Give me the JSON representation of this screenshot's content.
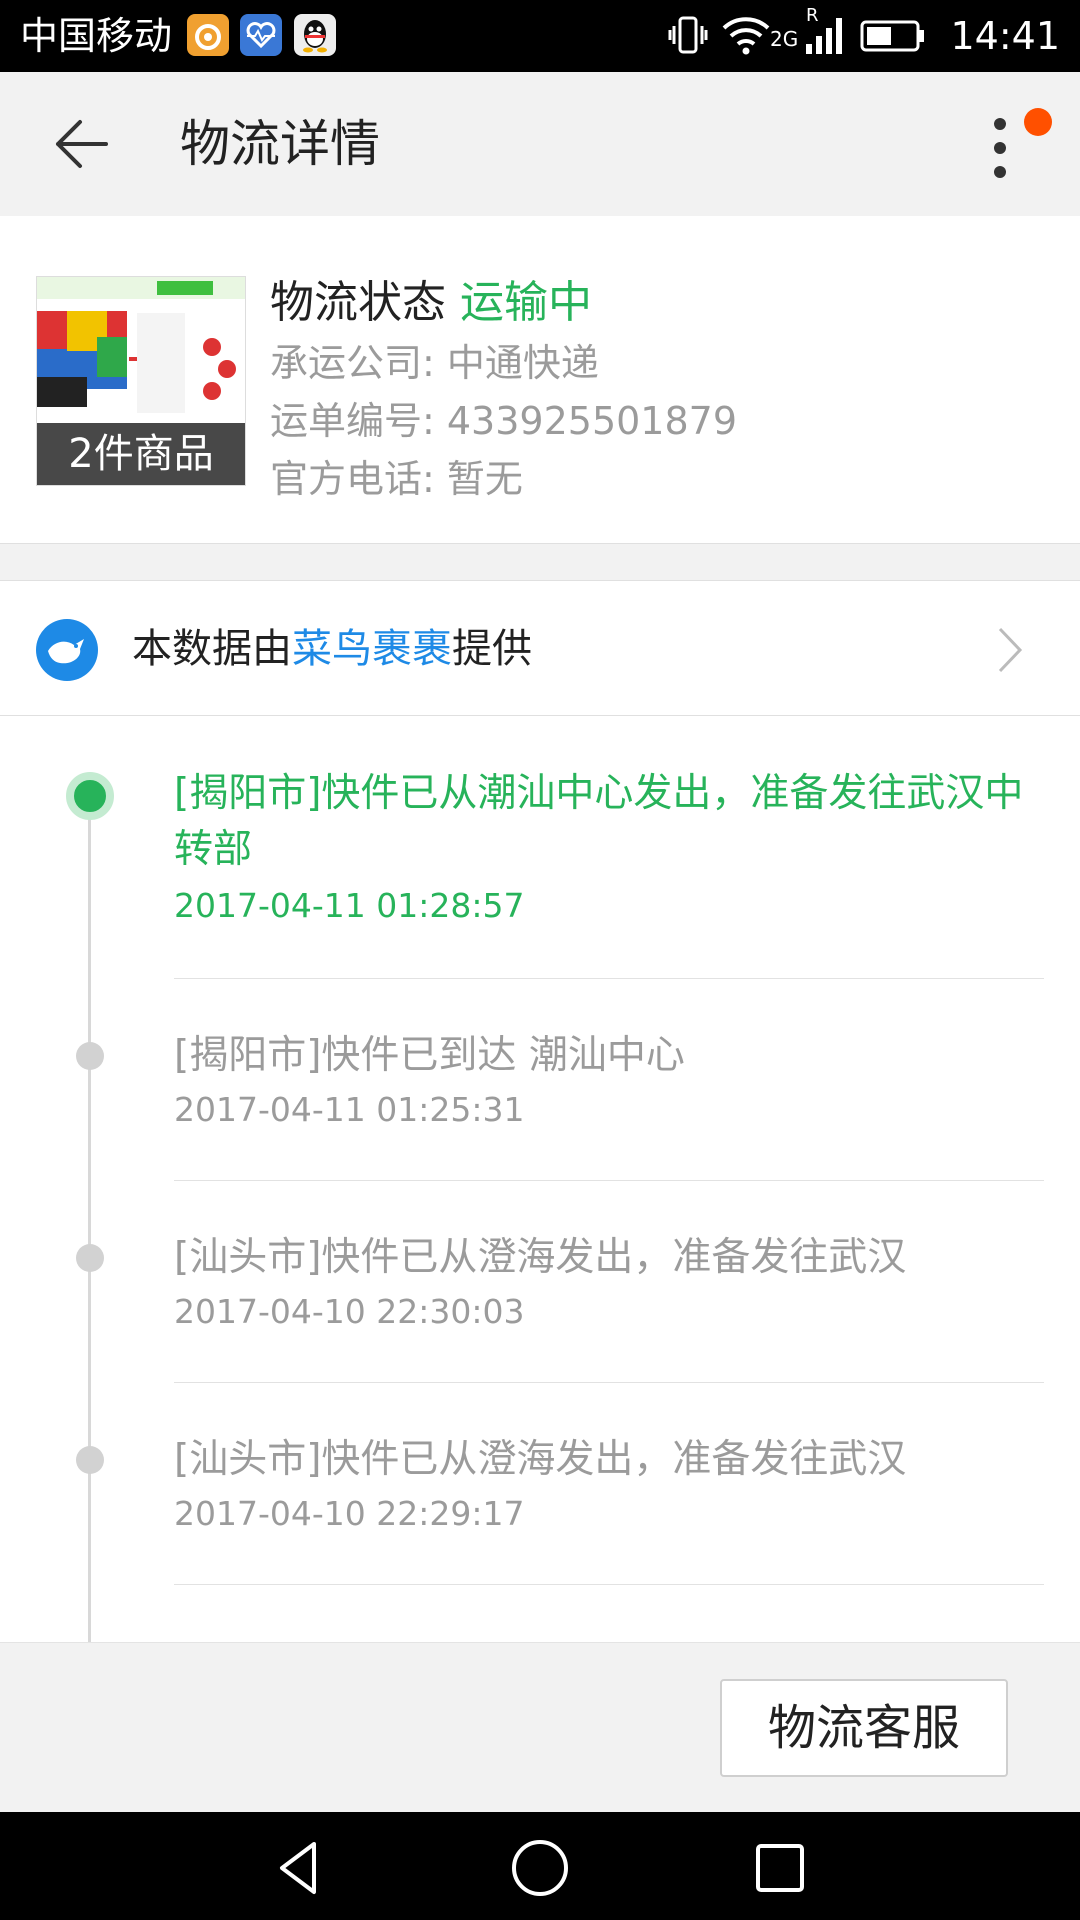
{
  "status_bar": {
    "carrier": "中国移动",
    "network": "2G",
    "roaming": "R",
    "time": "14:41",
    "app_icons": [
      "uc-browser-icon",
      "health-icon",
      "qq-icon"
    ]
  },
  "app_bar": {
    "title": "物流详情",
    "has_notification": true
  },
  "shipment": {
    "item_count_label": "2件商品",
    "status_label": "物流状态",
    "status_value": "运输中",
    "carrier_line": "承运公司: 中通快递",
    "tracking_line": "运单编号: 433925501879",
    "phone_line": "官方电话: 暂无"
  },
  "provider": {
    "prefix": "本数据由",
    "name": "菜鸟裹裹",
    "suffix": "提供"
  },
  "timeline": [
    {
      "description": "[揭阳市]快件已从潮汕中心发出，准备发往武汉中转部",
      "time": "2017-04-11 01:28:57",
      "current": true
    },
    {
      "description": "[揭阳市]快件已到达 潮汕中心",
      "time": "2017-04-11 01:25:31",
      "current": false
    },
    {
      "description": "[汕头市]快件已从澄海发出，准备发往武汉",
      "time": "2017-04-10 22:30:03",
      "current": false
    },
    {
      "description": "[汕头市]快件已从澄海发出，准备发往武汉",
      "time": "2017-04-10 22:29:17",
      "current": false
    }
  ],
  "actions": {
    "service_button": "物流客服"
  },
  "colors": {
    "accent_green": "#27b35a",
    "link_blue": "#1e8ae6",
    "notify_orange": "#ff5000"
  }
}
